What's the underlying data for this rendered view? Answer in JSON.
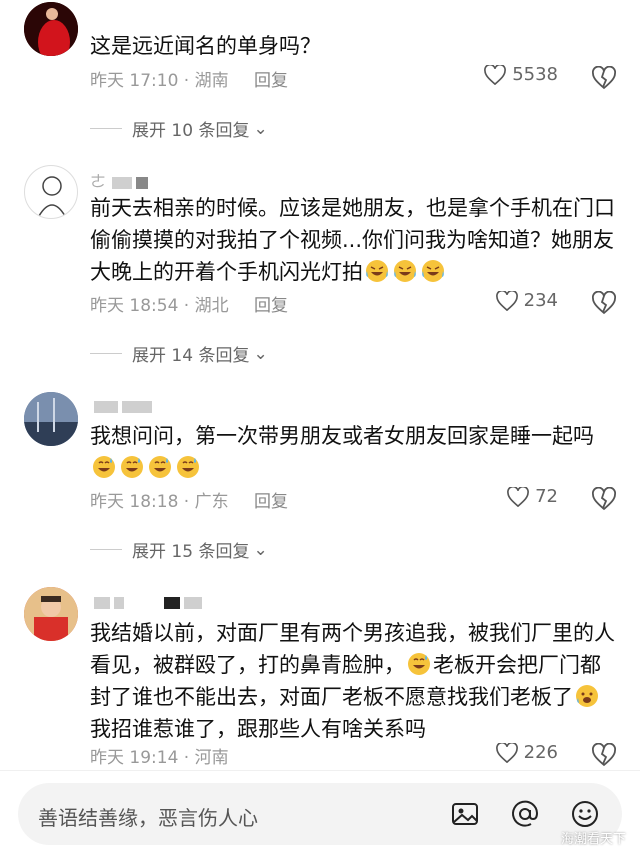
{
  "comments": [
    {
      "username_partial": "",
      "text": "这是远近闻名的单身吗？",
      "time": "昨天 17:10",
      "location": "湖南",
      "reply_label": "回复",
      "likes": "5538",
      "expand_label": "展开 10 条回复"
    },
    {
      "username_partial": "ㄜ",
      "text": "前天去相亲的时候。应该是她朋友，也是拿个手机在门口偷偷摸摸的对我拍了个视频...你们问我为啥知道？她朋友大晚上的开着个手机闪光灯拍",
      "time": "昨天 18:54",
      "location": "湖北",
      "reply_label": "回复",
      "likes": "234",
      "expand_label": "展开 14 条回复"
    },
    {
      "username_partial": "",
      "text": "我想问问，第一次带男朋友或者女朋友回家是睡一起吗",
      "time": "昨天 18:18",
      "location": "广东",
      "reply_label": "回复",
      "likes": "72",
      "expand_label": "展开 15 条回复"
    },
    {
      "username_partial": "",
      "text_part1": "我结婚以前，对面厂里有两个男孩追我，被我们厂里的人看见，被群殴了，打的鼻青脸肿，",
      "text_part2": "老板开会把厂门都封了谁也不能出去，对面厂老板不愿意找我们老板了",
      "text_part3": "我招谁惹谁了，跟那些人有啥关系吗",
      "time": "昨天 19:14",
      "location": "河南",
      "reply_label": "回复",
      "likes": "226"
    }
  ],
  "input": {
    "placeholder": "善语结善缘，恶言伤人心"
  },
  "watermark": "海潮看天下",
  "colors": {
    "emoji": "#f6c33b",
    "muted": "#999999"
  }
}
